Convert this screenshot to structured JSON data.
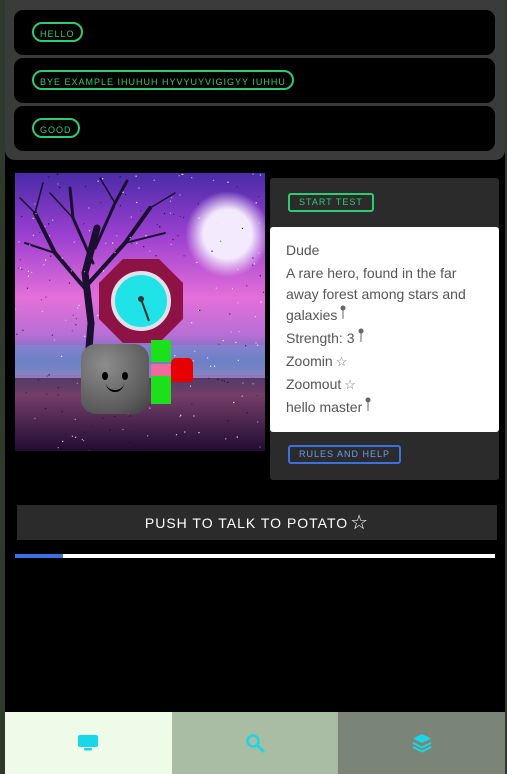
{
  "list_items": [
    {
      "label": "HELLO"
    },
    {
      "label": "BYE EXAMPLE IHUHUH HYVYUYVIGIGYY IUHHU"
    },
    {
      "label": "GOOD"
    }
  ],
  "card": {
    "start_button": "START TEST",
    "name": "Dude",
    "description": "A rare hero, found in the far away forest among stars and galaxies",
    "strength": "Strength: 3",
    "zoom_in": "Zoomin",
    "zoom_out": "Zoomout",
    "greeting": "hello master",
    "rules_button": "RULES AND HELP"
  },
  "talk_button": "PUSH TO TALK TO POTATO",
  "progress_fraction": 0.1,
  "tabs": [
    {
      "icon": "monitor-icon",
      "bg": "#eefbe8",
      "active": true
    },
    {
      "icon": "search-icon",
      "bg": "#a9bca4",
      "active": false
    },
    {
      "icon": "layers-icon",
      "bg": "#7a8577",
      "active": false
    }
  ],
  "colors": {
    "accent_green": "#2ecc71",
    "accent_blue": "#3a70e0",
    "icon_cyan": "#19d6e8",
    "gauge_ring": "#8e1345",
    "gauge_face": "#1fe3e6"
  }
}
